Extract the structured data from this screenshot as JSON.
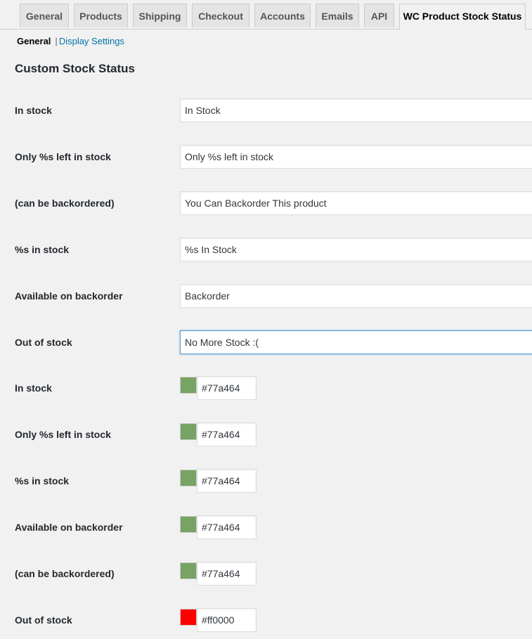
{
  "tabs": [
    {
      "label": "General"
    },
    {
      "label": "Products"
    },
    {
      "label": "Shipping"
    },
    {
      "label": "Checkout"
    },
    {
      "label": "Accounts"
    },
    {
      "label": "Emails"
    },
    {
      "label": "API"
    },
    {
      "label": "WC Product Stock Status",
      "active": true
    }
  ],
  "subnav": {
    "current": "General",
    "separator": "|",
    "link": "Display Settings"
  },
  "section_title": "Custom Stock Status",
  "text_fields": [
    {
      "label": "In stock",
      "value": "In Stock"
    },
    {
      "label": "Only %s left in stock",
      "value": "Only %s left in stock"
    },
    {
      "label": "(can be backordered)",
      "value": "You Can Backorder This product"
    },
    {
      "label": "%s in stock",
      "value": "%s In Stock"
    },
    {
      "label": "Available on backorder",
      "value": "Backorder"
    },
    {
      "label": "Out of stock",
      "value": "No More Stock :(",
      "focused": true
    }
  ],
  "color_fields": [
    {
      "label": "In stock",
      "value": "#77a464",
      "color": "#77a464"
    },
    {
      "label": "Only %s left in stock",
      "value": "#77a464",
      "color": "#77a464"
    },
    {
      "label": "%s in stock",
      "value": "#77a464",
      "color": "#77a464"
    },
    {
      "label": "Available on backorder",
      "value": "#77a464",
      "color": "#77a464"
    },
    {
      "label": "(can be backordered)",
      "value": "#77a464",
      "color": "#77a464"
    },
    {
      "label": "Out of stock",
      "value": "#ff0000",
      "color": "#ff0000"
    }
  ]
}
